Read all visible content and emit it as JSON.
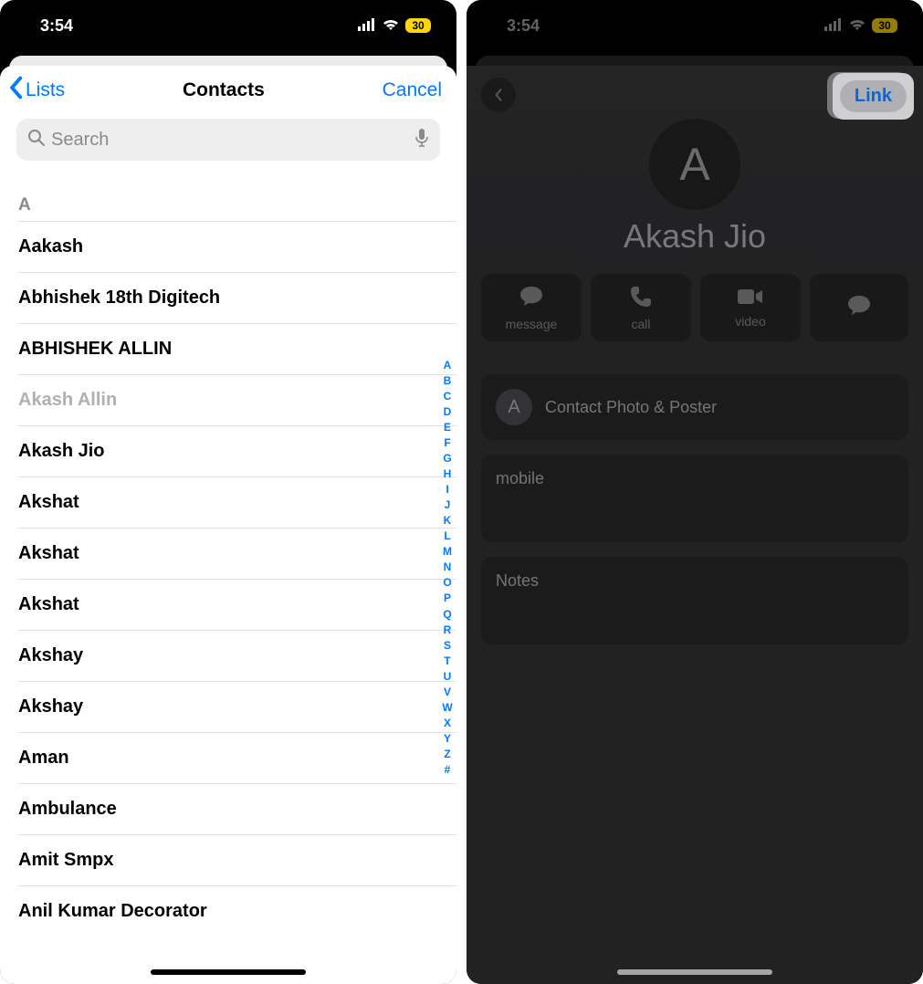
{
  "status": {
    "time": "3:54",
    "battery": "30"
  },
  "left": {
    "nav": {
      "back": "Lists",
      "title": "Contacts",
      "cancel": "Cancel"
    },
    "search": {
      "placeholder": "Search"
    },
    "section": "A",
    "contacts": [
      {
        "name": "Aakash",
        "disabled": false
      },
      {
        "name": "Abhishek 18th Digitech",
        "disabled": false
      },
      {
        "name": "ABHISHEK ALLIN",
        "disabled": false
      },
      {
        "name": "Akash Allin",
        "disabled": true
      },
      {
        "name": "Akash Jio",
        "disabled": false
      },
      {
        "name": "Akshat",
        "disabled": false
      },
      {
        "name": "Akshat",
        "disabled": false
      },
      {
        "name": "Akshat",
        "disabled": false
      },
      {
        "name": "Akshay",
        "disabled": false
      },
      {
        "name": "Akshay",
        "disabled": false
      },
      {
        "name": "Aman",
        "disabled": false
      },
      {
        "name": "Ambulance",
        "disabled": false
      },
      {
        "name": "Amit Smpx",
        "disabled": false
      },
      {
        "name": "Anil Kumar Decorator",
        "disabled": false
      }
    ],
    "index": [
      "A",
      "B",
      "C",
      "D",
      "E",
      "F",
      "G",
      "H",
      "I",
      "J",
      "K",
      "L",
      "M",
      "N",
      "O",
      "P",
      "Q",
      "R",
      "S",
      "T",
      "U",
      "V",
      "W",
      "X",
      "Y",
      "Z",
      "#"
    ]
  },
  "right": {
    "link_label": "Link",
    "avatar_letter": "A",
    "contact_name": "Akash Jio",
    "actions": {
      "message": "message",
      "call": "call",
      "video": "video",
      "more": ""
    },
    "photo_poster": "Contact Photo & Poster",
    "mobile": "mobile",
    "notes": "Notes"
  }
}
